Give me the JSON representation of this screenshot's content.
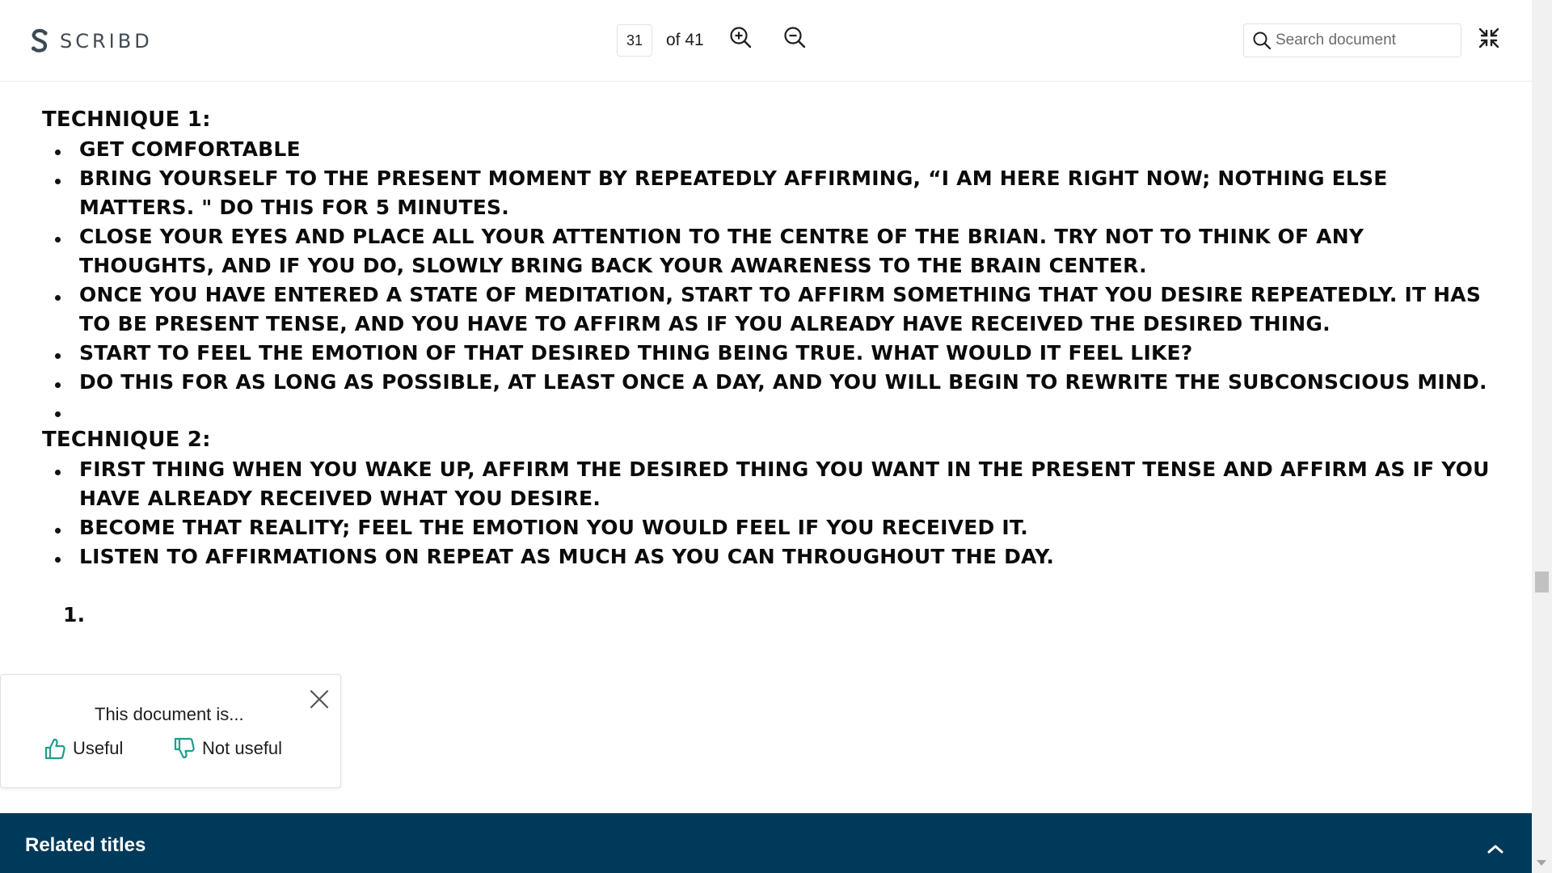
{
  "header": {
    "logo_text": "SCRIBD",
    "page_number": "31",
    "page_total_label": "of 41",
    "search_placeholder": "Search document",
    "icons": {
      "logo": "scribd-logo-icon",
      "zoom_in": "zoom-in-icon",
      "zoom_out": "zoom-out-icon",
      "search": "search-icon",
      "exit_fullscreen": "exit-fullscreen-icon"
    }
  },
  "document": {
    "technique1_heading": "TECHNIQUE 1:",
    "technique1_items": [
      "GET COMFORTABLE",
      "BRING YOURSELF TO THE PRESENT MOMENT BY REPEATEDLY AFFIRMING, “I AM HERE RIGHT NOW; NOTHING ELSE MATTERS. \" DO THIS FOR 5 MINUTES.",
      "CLOSE YOUR EYES AND PLACE ALL YOUR ATTENTION TO THE CENTRE OF THE BRIAN. TRY NOT TO THINK OF ANY THOUGHTS, AND IF YOU DO, SLOWLY BRING BACK YOUR AWARENESS TO THE BRAIN CENTER.",
      "ONCE YOU HAVE ENTERED A STATE OF MEDITATION, START TO AFFIRM SOMETHING THAT YOU DESIRE REPEATEDLY. IT HAS TO BE PRESENT TENSE, AND YOU HAVE TO AFFIRM AS IF YOU ALREADY HAVE RECEIVED THE DESIRED THING.",
      "START TO FEEL THE EMOTION OF THAT DESIRED THING BEING TRUE. WHAT WOULD IT FEEL LIKE?",
      "DO THIS FOR AS LONG AS POSSIBLE, AT LEAST ONCE A DAY, AND YOU WILL BEGIN TO REWRITE THE SUBCONSCIOUS MIND.",
      ""
    ],
    "technique2_heading": "TECHNIQUE 2:",
    "technique2_items": [
      "FIRST THING WHEN YOU WAKE UP, AFFIRM THE DESIRED THING YOU WANT IN THE PRESENT TENSE AND AFFIRM AS IF YOU HAVE ALREADY RECEIVED WHAT YOU DESIRE.",
      "BECOME THAT REALITY; FEEL THE EMOTION YOU WOULD FEEL IF YOU RECEIVED IT.",
      "LISTEN TO AFFIRMATIONS ON REPEAT AS MUCH AS YOU CAN THROUGHOUT THE DAY."
    ],
    "numbered_marker": "1."
  },
  "feedback": {
    "title": "This document is...",
    "useful_label": "Useful",
    "not_useful_label": "Not useful",
    "accent_color": "#1e9e8c",
    "icons": {
      "close": "close-icon",
      "useful": "thumbs-up-icon",
      "not_useful": "thumbs-down-icon"
    }
  },
  "related": {
    "title": "Related titles",
    "background_color": "#003a5a",
    "toggle_icon": "chevron-up-icon"
  }
}
